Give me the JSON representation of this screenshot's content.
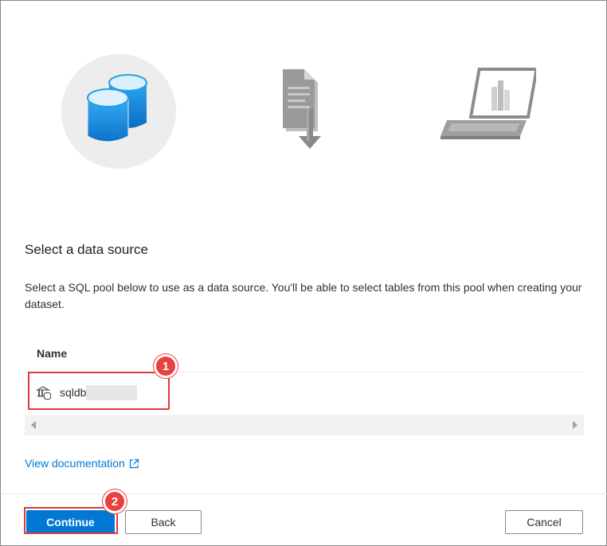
{
  "illustrations": {
    "database": "database-icon",
    "document": "document-download-icon",
    "laptop": "laptop-report-icon"
  },
  "heading": "Select a data source",
  "description": "Select a SQL pool below to use as a data source. You'll be able to select tables from this pool when creating your dataset.",
  "grid": {
    "column_header": "Name",
    "rows": [
      {
        "icon": "sql-pool-icon",
        "name": "sqldb"
      }
    ]
  },
  "annotations": {
    "badge1": "1",
    "badge2": "2"
  },
  "link": {
    "label": "View documentation",
    "icon": "external-link-icon"
  },
  "buttons": {
    "continue": "Continue",
    "back": "Back",
    "cancel": "Cancel"
  },
  "colors": {
    "accent": "#0078d4",
    "highlight": "#e03a3a",
    "db_blue": "#1e8fe1"
  }
}
